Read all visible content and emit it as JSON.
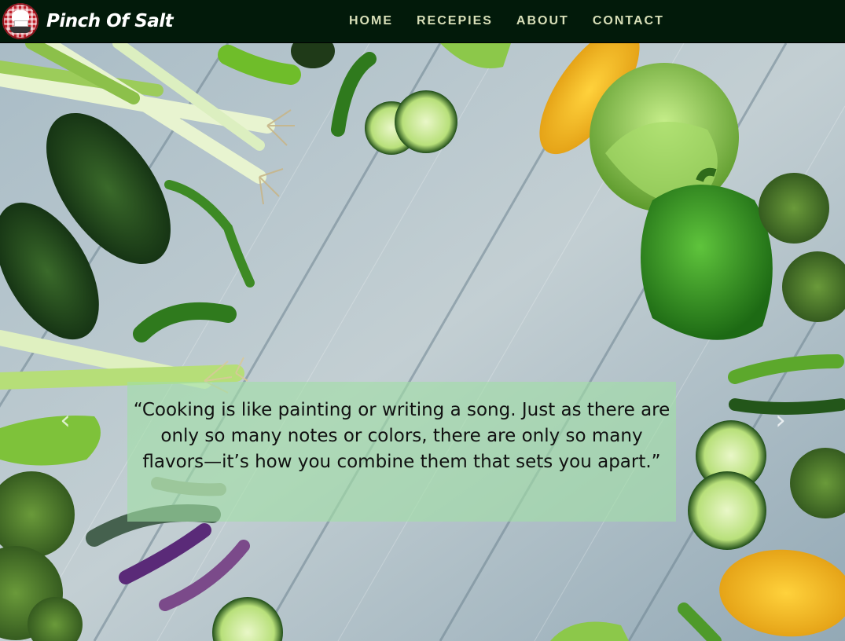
{
  "brand": {
    "name": "Pinch Of Salt",
    "logo_icon": "chef-hat-logo-icon"
  },
  "nav": {
    "items": [
      {
        "label": "HOME"
      },
      {
        "label": "RECEPIES"
      },
      {
        "label": "ABOUT"
      },
      {
        "label": "CONTACT"
      }
    ]
  },
  "hero": {
    "background_description_icon": "vegetables-on-wood-table-image",
    "prev_icon": "chevron-left-icon",
    "next_icon": "chevron-right-icon",
    "prev_glyph": "‹",
    "next_glyph": "›",
    "quote": "“Cooking is like painting or writing a song. Just as there are only so many notes or colors, there are only so many flavors—it’s how you combine them that sets you apart.”"
  },
  "colors": {
    "navbar_bg": "#021a0a",
    "nav_link": "#d8dfb8",
    "caption_bg": "#a2dea6"
  }
}
